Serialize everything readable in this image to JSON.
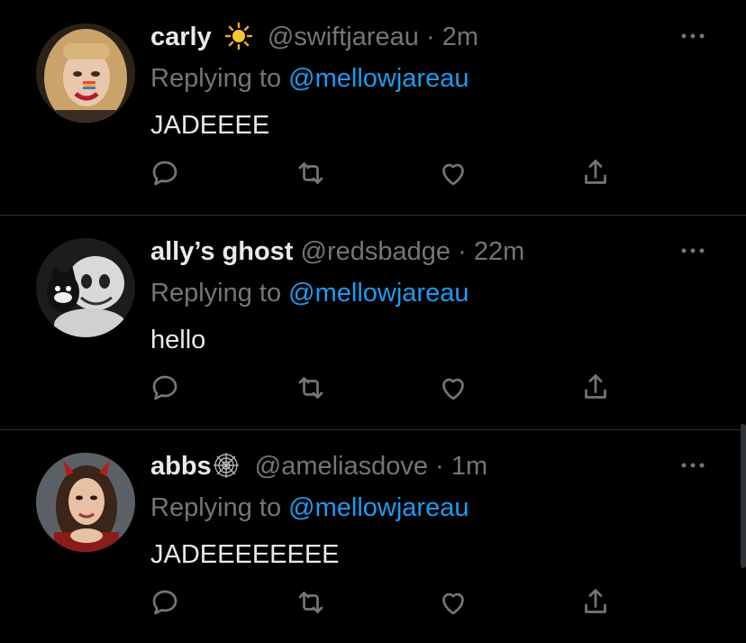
{
  "tweets": [
    {
      "name": "carly",
      "name_emoji": "sun-icon",
      "handle": "@swiftjareau",
      "dot": "·",
      "time": "2m",
      "reply_prefix": "Replying to",
      "reply_to": "@mellowjareau",
      "body": "JADEEEE"
    },
    {
      "name": "ally’s ghost",
      "name_emoji": "",
      "handle": "@redsbadge",
      "dot": "·",
      "time": "22m",
      "reply_prefix": "Replying to",
      "reply_to": "@mellowjareau",
      "body": "hello"
    },
    {
      "name": "abbs",
      "name_emoji": "spider-web-icon",
      "handle": "@ameliasdove",
      "dot": "·",
      "time": "1m",
      "reply_prefix": "Replying to",
      "reply_to": "@mellowjareau",
      "body": "JADEEEEEEEE"
    }
  ],
  "colors": {
    "background": "#000000",
    "text": "#e7e9ea",
    "muted": "#71767b",
    "accent": "#1d9bf0",
    "divider": "#2f3336"
  },
  "icons": {
    "reply": "reply-icon",
    "retweet": "retweet-icon",
    "like": "heart-icon",
    "share": "share-icon",
    "more": "more-dots-icon"
  }
}
